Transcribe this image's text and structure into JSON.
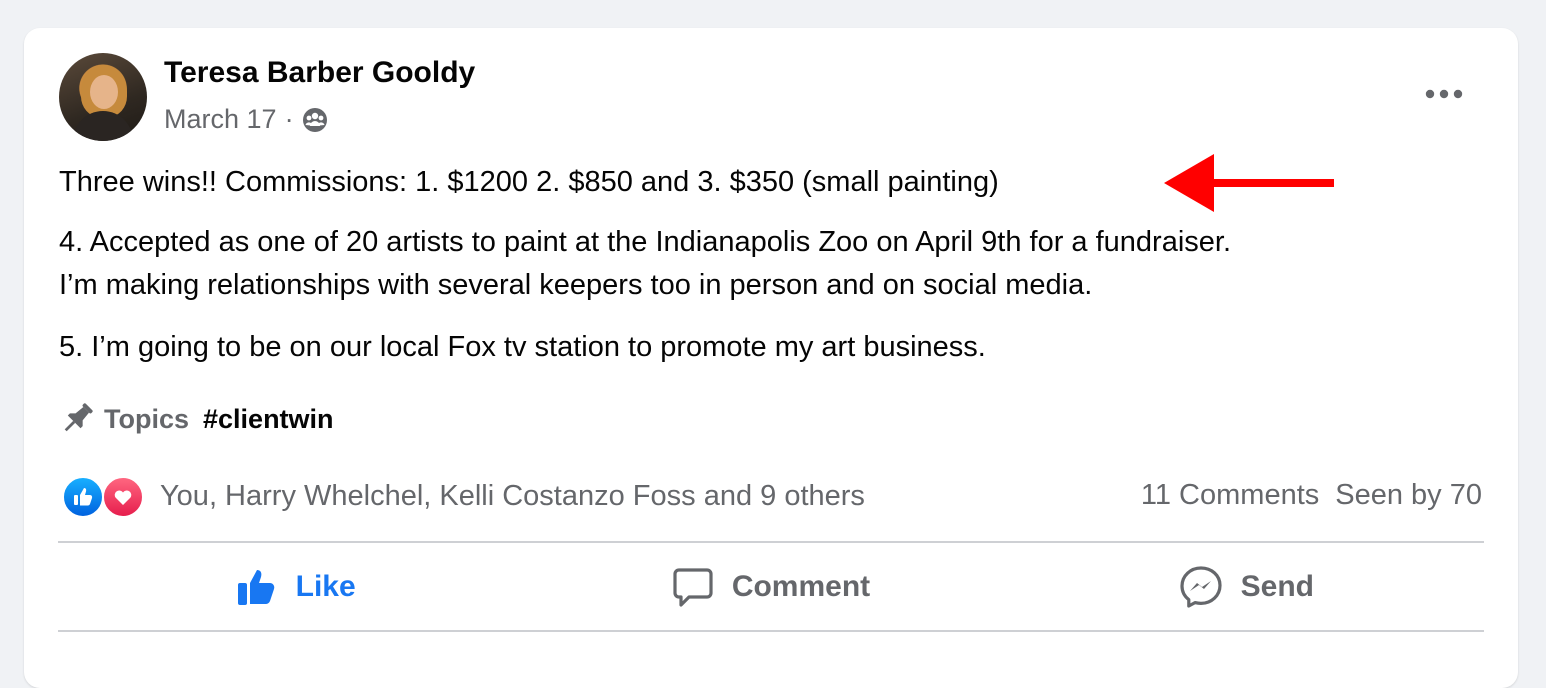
{
  "post": {
    "author": "Teresa Barber Gooldy",
    "date": "March 17",
    "separator": "·",
    "audience_icon": "group-icon",
    "more_icon": "more-horizontal-icon",
    "paragraphs": [
      "Three wins!! Commissions: 1. $1200 2. $850 and 3. $350 (small painting)",
      "4. Accepted as one of 20 artists to paint at the Indianapolis Zoo on April 9th for a fundraiser.",
      "I’m making relationships with several keepers too in person and on social media.",
      "5. I’m going to be on our local Fox tv station to promote my art business."
    ],
    "annotation_arrow_color": "#ff0000"
  },
  "topics": {
    "icon": "pin-icon",
    "label": "Topics",
    "tag": "#clientwin"
  },
  "reactions": {
    "icons": [
      "like-reaction-icon",
      "love-reaction-icon"
    ],
    "summary": "You, Harry Whelchel, Kelli Costanzo Foss and 9 others",
    "comments": "11 Comments",
    "seen": "Seen by 70"
  },
  "actions": {
    "like": "Like",
    "comment": "Comment",
    "send": "Send"
  },
  "colors": {
    "page_bg": "#f0f2f5",
    "card_bg": "#ffffff",
    "primary_blue": "#1877f2",
    "secondary_text": "#65676b",
    "love_red": "#e61e4d"
  }
}
